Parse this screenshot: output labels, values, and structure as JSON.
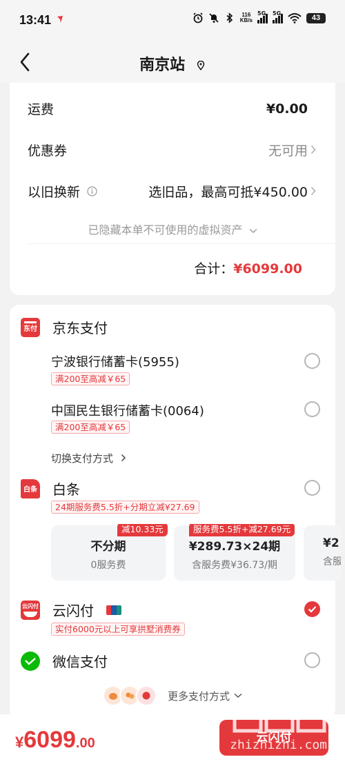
{
  "status_bar": {
    "time": "13:41",
    "net_speed_value": "116",
    "net_speed_unit": "KB/s",
    "signal1": "5G",
    "signal2": "5G",
    "battery": "43"
  },
  "nav": {
    "title": "南京站"
  },
  "summary": {
    "shipping_label": "运费",
    "shipping_value": "¥0.00",
    "coupon_label": "优惠券",
    "coupon_value": "无可用",
    "tradein_label": "以旧换新",
    "tradein_value": "选旧品，最高可抵¥450.00",
    "hidden_assets_note": "已隐藏本单不可使用的虚拟资产",
    "total_label": "合计：",
    "total_value": "¥6099.00"
  },
  "payment": {
    "jd_pay": {
      "label": "京东支付",
      "logo_text": "东付",
      "cards": [
        {
          "name": "宁波银行储蓄卡(5955)",
          "promo": "满200至高减￥65"
        },
        {
          "name": "中国民生银行储蓄卡(0064)",
          "promo": "满200至高减￥65"
        }
      ],
      "switch_label": "切换支付方式"
    },
    "baitiao": {
      "label": "白条",
      "logo_text": "白条",
      "promo": "24期服务费5.5折+分期立减¥27.69",
      "plans": [
        {
          "tag": "减10.33元",
          "main": "不分期",
          "sub": "0服务费"
        },
        {
          "tag": "服务费5.5折+减27.69元",
          "main": "¥289.73×24期",
          "sub": "含服务费¥36.73/期"
        },
        {
          "main": "¥2",
          "sub": "含服"
        }
      ]
    },
    "yunshanfu": {
      "label": "云闪付",
      "logo_text": "云闪付",
      "unionpay_text": "银联",
      "promo": "实付6000元以上可享拱墅消费券"
    },
    "wechat": {
      "label": "微信支付"
    },
    "more_label": "更多支付方式"
  },
  "bottom": {
    "currency": "¥",
    "price_int": "6099",
    "price_dec": ".00",
    "pay_button": "云闪付"
  },
  "watermark": {
    "text": "zhizhizhi.com"
  },
  "colors": {
    "accent": "#e4393c",
    "background": "#f2f2f2",
    "card": "#ffffff",
    "muted": "#8a8a8a",
    "wechat_green": "#09bb07"
  }
}
